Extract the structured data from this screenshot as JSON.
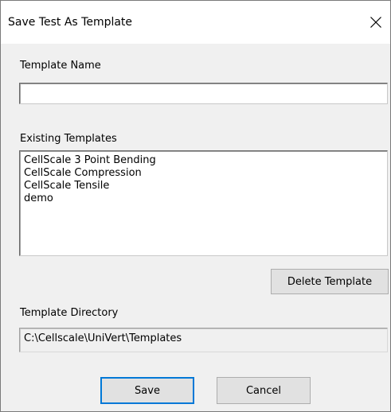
{
  "window": {
    "title": "Save Test As Template",
    "close_icon": "close-icon"
  },
  "template_name": {
    "label": "Template Name",
    "value": "",
    "placeholder": ""
  },
  "existing_templates": {
    "label": "Existing Templates",
    "items": [
      "CellScale 3 Point Bending",
      "CellScale Compression",
      "CellScale Tensile",
      "demo"
    ]
  },
  "buttons": {
    "delete_template": "Delete Template",
    "save": "Save",
    "cancel": "Cancel"
  },
  "template_directory": {
    "label": "Template Directory",
    "value": "C:\\Cellscale\\UniVert\\Templates"
  },
  "colors": {
    "dialog_background": "#f0f0f0",
    "title_background": "#ffffff",
    "default_button_border": "#0078d7",
    "button_face": "#e1e1e1"
  }
}
